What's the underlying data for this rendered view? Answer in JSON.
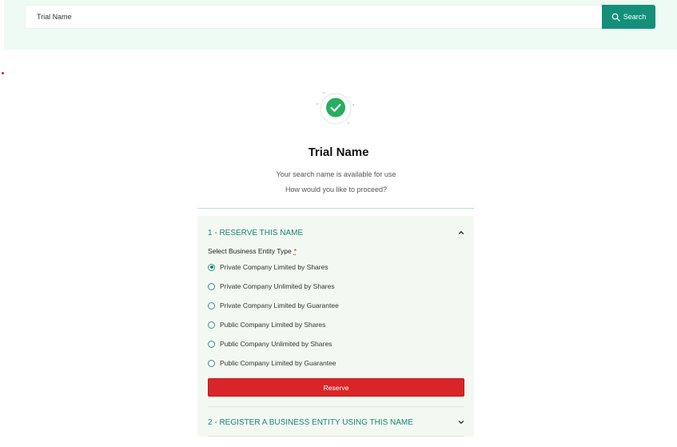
{
  "search": {
    "value": "Trial Name",
    "button_label": "Search"
  },
  "result": {
    "title": "Trial Name",
    "line1": "Your search name is available for use",
    "line2": "How would you like to proceed?"
  },
  "section1": {
    "title": "1 - RESERVE THIS NAME",
    "field_label": "Select Business Entity Type",
    "required_mark": "*",
    "options": [
      "Private Company Limited by Shares",
      "Private Company Unlimited by Shares",
      "Private Company Limited by Guarantee",
      "Public Company Limited by Shares",
      "Public Company Unlimited by Shares",
      "Public Company Limited by Guarantee"
    ],
    "selected_index": 0,
    "reserve_label": "Reserve"
  },
  "section2": {
    "title": "2 - REGISTER A BUSINESS ENTITY USING THIS NAME"
  },
  "colors": {
    "accent": "#138f7a",
    "danger": "#d92528",
    "success": "#27ae60",
    "header_bg": "#eefaf4",
    "panel_bg": "#f3f8f2"
  },
  "icons": {
    "search": "search-icon",
    "success": "check-circle-icon",
    "expanded": "chevron-up-icon",
    "collapsed": "chevron-down-icon"
  }
}
